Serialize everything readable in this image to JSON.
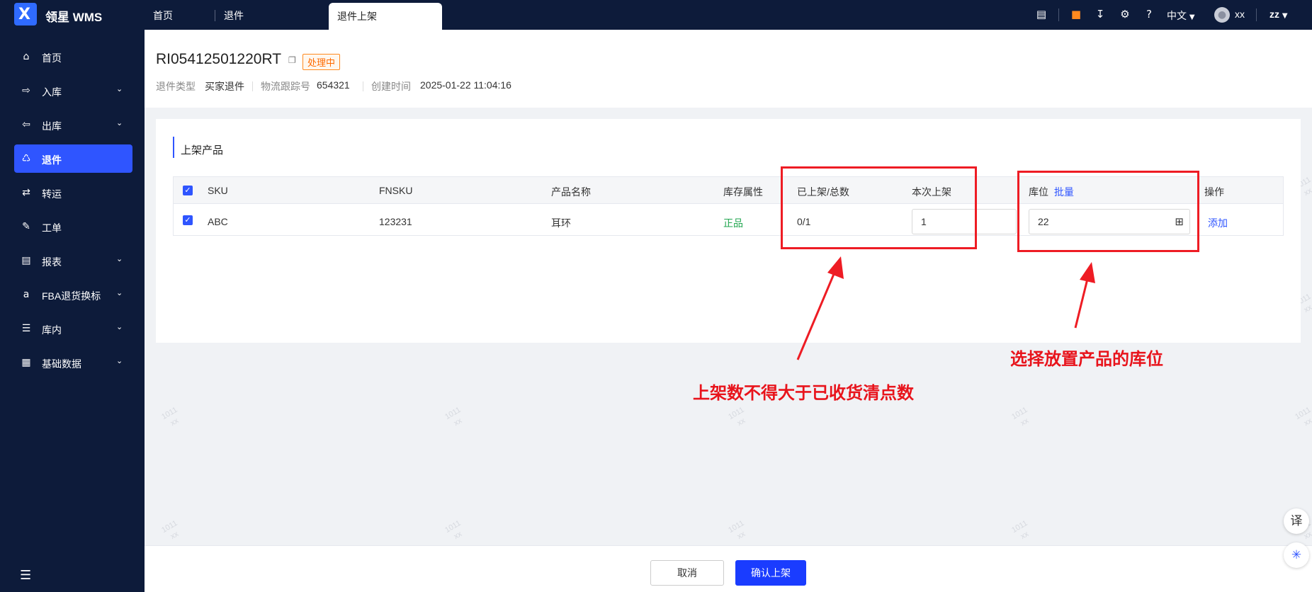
{
  "app": {
    "title": "领星 WMS",
    "logo_letter": "X"
  },
  "tabs": [
    {
      "label": "首页"
    },
    {
      "label": "退件"
    },
    {
      "label": "退件上架"
    }
  ],
  "topbar": {
    "language": "中文",
    "user": "xx",
    "account": "zz"
  },
  "sidebar": {
    "items": [
      {
        "label": "首页",
        "icon": "home-icon"
      },
      {
        "label": "入库",
        "icon": "inbound-icon"
      },
      {
        "label": "出库",
        "icon": "outbound-icon"
      },
      {
        "label": "退件",
        "icon": "return-icon"
      },
      {
        "label": "转运",
        "icon": "transfer-icon"
      },
      {
        "label": "工单",
        "icon": "workorder-icon"
      },
      {
        "label": "报表",
        "icon": "report-icon"
      },
      {
        "label": "FBA退货换标",
        "icon": "fba-icon"
      },
      {
        "label": "库内",
        "icon": "warehouse-icon"
      },
      {
        "label": "基础数据",
        "icon": "data-icon"
      }
    ]
  },
  "header": {
    "order_no": "RI05412501220RT",
    "status": "处理中",
    "type_label": "退件类型",
    "type_value": "买家退件",
    "tracking_label": "物流跟踪号",
    "tracking_value": "654321",
    "created_label": "创建时间",
    "created_value": "2025-01-22 11:04:16"
  },
  "section": {
    "title": "上架产品"
  },
  "table": {
    "columns": {
      "sku": "SKU",
      "fnsku": "FNSKU",
      "name": "产品名称",
      "attr": "库存属性",
      "shelved_total": "已上架/总数",
      "this_shelve": "本次上架",
      "location": "库位",
      "batch": "批量",
      "action": "操作"
    },
    "rows": [
      {
        "sku": "ABC",
        "fnsku": "123231",
        "name": "耳环",
        "attr": "正品",
        "shelved_total": "0/1",
        "this_shelve": "1",
        "location": "22",
        "action": "添加"
      }
    ]
  },
  "annotations": {
    "left": "上架数不得大于已收货清点数",
    "right": "选择放置产品的库位"
  },
  "footer": {
    "cancel": "取消",
    "confirm": "确认上架"
  },
  "watermark": {
    "line1": "1011",
    "line2": "xx"
  },
  "colors": {
    "primary": "#2f55ff",
    "sidebar": "#0d1b3a",
    "annotation": "#ee1c24",
    "status": "#ff6a00",
    "genuine": "#22a650"
  }
}
